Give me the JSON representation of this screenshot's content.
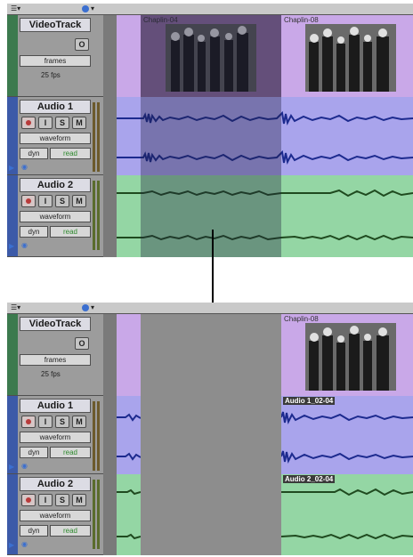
{
  "colors": {
    "video_region": "#c9a8e8",
    "video_region_dark": "#8a6b9c",
    "audio1_region": "#a9a4ec",
    "audio2_region": "#94d6a4",
    "wave1": "#1c2a8e",
    "wave2": "#1f4a1f",
    "selection": "#3b3b6b",
    "strip_video": "#3c7a4e",
    "strip_audio": "#3c5aa8",
    "arrow": "#000000"
  },
  "before": {
    "video_track": {
      "name": "VideoTrack",
      "btn_o": "O",
      "format": "frames",
      "fps": "25 fps",
      "clips": [
        {
          "label": "Chaplin-04"
        },
        {
          "label": "Chaplin-08"
        }
      ]
    },
    "audio1": {
      "name": "Audio 1",
      "i": "I",
      "s": "S",
      "m": "M",
      "view": "waveform",
      "dyn": "dyn",
      "mode": "read"
    },
    "audio2": {
      "name": "Audio 2",
      "i": "I",
      "s": "S",
      "m": "M",
      "view": "waveform",
      "dyn": "dyn",
      "mode": "read"
    }
  },
  "after": {
    "video_track": {
      "name": "VideoTrack",
      "btn_o": "O",
      "format": "frames",
      "fps": "25 fps",
      "clips": [
        {
          "label": "Chaplin-08"
        }
      ]
    },
    "audio1": {
      "name": "Audio 1",
      "i": "I",
      "s": "S",
      "m": "M",
      "view": "waveform",
      "dyn": "dyn",
      "mode": "read",
      "region_name": "Audio 1_02-04"
    },
    "audio2": {
      "name": "Audio 2",
      "i": "I",
      "s": "S",
      "m": "M",
      "view": "waveform",
      "dyn": "dyn",
      "mode": "read",
      "region_name": "Audio 2_02-04"
    }
  }
}
